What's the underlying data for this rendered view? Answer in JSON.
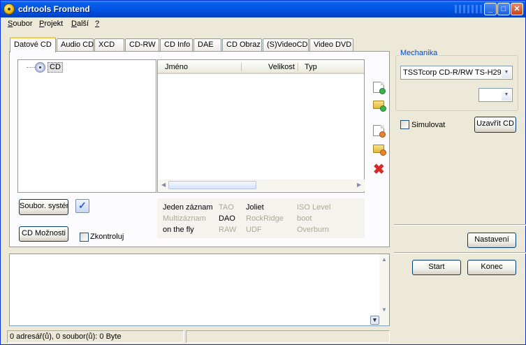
{
  "window": {
    "title": "cdrtools Frontend"
  },
  "menu": [
    {
      "underline": "S",
      "rest": "oubor"
    },
    {
      "underline": "P",
      "rest": "rojekt"
    },
    {
      "underline": "D",
      "rest": "alší"
    },
    {
      "underline": "?",
      "rest": ""
    }
  ],
  "tabs": [
    "Datové CD",
    "Audio CD",
    "XCD",
    "CD-RW",
    "CD Info",
    "DAE",
    "CD Obraz",
    "(S)VideoCD",
    "Video DVD"
  ],
  "active_tab": "Datové CD",
  "tree": {
    "root_label": "CD"
  },
  "filelist": {
    "columns": [
      "Jméno",
      "Velikost",
      "Typ"
    ]
  },
  "buttons": {
    "filesystem": "Soubor. systém",
    "cd_options": "CD Možnosti",
    "close_cd": "Uzavřít CD",
    "settings": "Nastavení",
    "start": "Start",
    "exit": "Konec"
  },
  "checkboxes": {
    "verify": "Zkontroluj",
    "simulate": "Simulovat"
  },
  "info": {
    "row1": [
      "Jeden záznam",
      "TAO",
      "Joliet",
      "ISO Level"
    ],
    "row2": [
      "Multizáznam",
      "DAO",
      "RockRidge",
      "boot"
    ],
    "row3": [
      "on the fly",
      "RAW",
      "UDF",
      "Overburn"
    ]
  },
  "drive": {
    "group_label": "Mechanika",
    "selected": "TSSTcorp CD-R/RW TS-H29",
    "speed": ""
  },
  "status": {
    "text": "0 adresář(ů), 0 soubor(ů): 0 Byte"
  },
  "colors": {
    "title_bar": "#0055e5",
    "accent_tab": "#ffc83c",
    "group_title": "#0046d5",
    "delete_icon": "#d42a2a"
  }
}
